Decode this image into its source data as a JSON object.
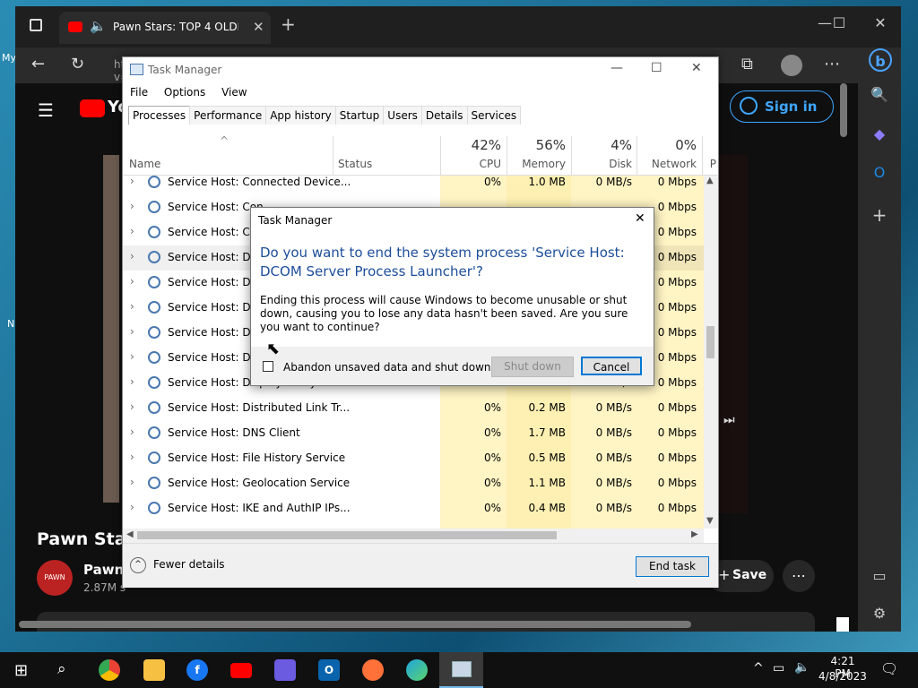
{
  "desktop": {
    "icon_label_1": "My",
    "icon_label_2": "N"
  },
  "browser": {
    "tab_title": "Pawn Stars: TOP 4 OLDEST ITEMS",
    "new_tab": "+",
    "url": "https://www.youtube.com/watch?v=PMKoROIDZ",
    "youtube": {
      "logo": "You",
      "sign_in": "Sign in",
      "video_title": "Pawn Stars",
      "channel_name": "Pawn",
      "subscribers": "2.87M s",
      "save_label": "Save",
      "channel_avatar_text": "PAWN"
    }
  },
  "task_manager": {
    "title": "Task Manager",
    "menu": [
      "File",
      "Options",
      "View"
    ],
    "tabs": [
      "Processes",
      "Performance",
      "App history",
      "Startup",
      "Users",
      "Details",
      "Services"
    ],
    "columns": {
      "name": "Name",
      "status": "Status",
      "cpu_pct": "42%",
      "cpu": "CPU",
      "mem_pct": "56%",
      "mem": "Memory",
      "disk_pct": "4%",
      "disk": "Disk",
      "net_pct": "0%",
      "net": "Network",
      "power": "P"
    },
    "rows": [
      {
        "name": "Service Host: Connected Device...",
        "cpu": "0%",
        "mem": "1.0 MB",
        "disk": "0 MB/s",
        "net": "0 Mbps"
      },
      {
        "name": "Service Host: Con",
        "cpu": "",
        "mem": "",
        "disk": "",
        "net": "0 Mbps"
      },
      {
        "name": "Service Host: Cryp",
        "cpu": "",
        "mem": "",
        "disk": "",
        "net": "0 Mbps"
      },
      {
        "name": "Service Host: DCO",
        "cpu": "",
        "mem": "",
        "disk": "",
        "net": "0 Mbps"
      },
      {
        "name": "Service Host: DHC",
        "cpu": "",
        "mem": "",
        "disk": "",
        "net": "0 Mbps"
      },
      {
        "name": "Service Host: Diag",
        "cpu": "",
        "mem": "",
        "disk": "",
        "net": "0 Mbps"
      },
      {
        "name": "Service Host: Diag",
        "cpu": "",
        "mem": "",
        "disk": "",
        "net": "0 Mbps"
      },
      {
        "name": "Service Host: Diag",
        "cpu": "",
        "mem": "",
        "disk": "",
        "net": "0 Mbps"
      },
      {
        "name": "Service Host: Display Policy Serv...",
        "cpu": "0%",
        "mem": "0.4 MB",
        "disk": "0 MB/s",
        "net": "0 Mbps"
      },
      {
        "name": "Service Host: Distributed Link Tr...",
        "cpu": "0%",
        "mem": "0.2 MB",
        "disk": "0 MB/s",
        "net": "0 Mbps"
      },
      {
        "name": "Service Host: DNS Client",
        "cpu": "0%",
        "mem": "1.7 MB",
        "disk": "0 MB/s",
        "net": "0 Mbps"
      },
      {
        "name": "Service Host: File History Service",
        "cpu": "0%",
        "mem": "0.5 MB",
        "disk": "0 MB/s",
        "net": "0 Mbps"
      },
      {
        "name": "Service Host: Geolocation Service",
        "cpu": "0%",
        "mem": "1.1 MB",
        "disk": "0 MB/s",
        "net": "0 Mbps"
      },
      {
        "name": "Service Host: IKE and AuthIP IPs...",
        "cpu": "0%",
        "mem": "0.4 MB",
        "disk": "0 MB/s",
        "net": "0 Mbps"
      }
    ],
    "fewer_details": "Fewer details",
    "end_task": "End task"
  },
  "dialog": {
    "title": "Task Manager",
    "question": "Do you want to end the system process 'Service Host: DCOM Server Process Launcher'?",
    "body": "Ending this process will cause Windows to become unusable or shut down, causing you to lose any data hasn't been saved. Are you sure you want to continue?",
    "checkbox_label": "Abandon unsaved data and shut down.",
    "shutdown_label": "Shut down",
    "cancel_label": "Cancel"
  },
  "taskbar": {
    "time": "4:21 PM",
    "date": "4/8/2023"
  },
  "colors": {
    "accent": "#0078d4",
    "shade": "#fff4c4",
    "dialog_heading": "#1d4e9b"
  }
}
